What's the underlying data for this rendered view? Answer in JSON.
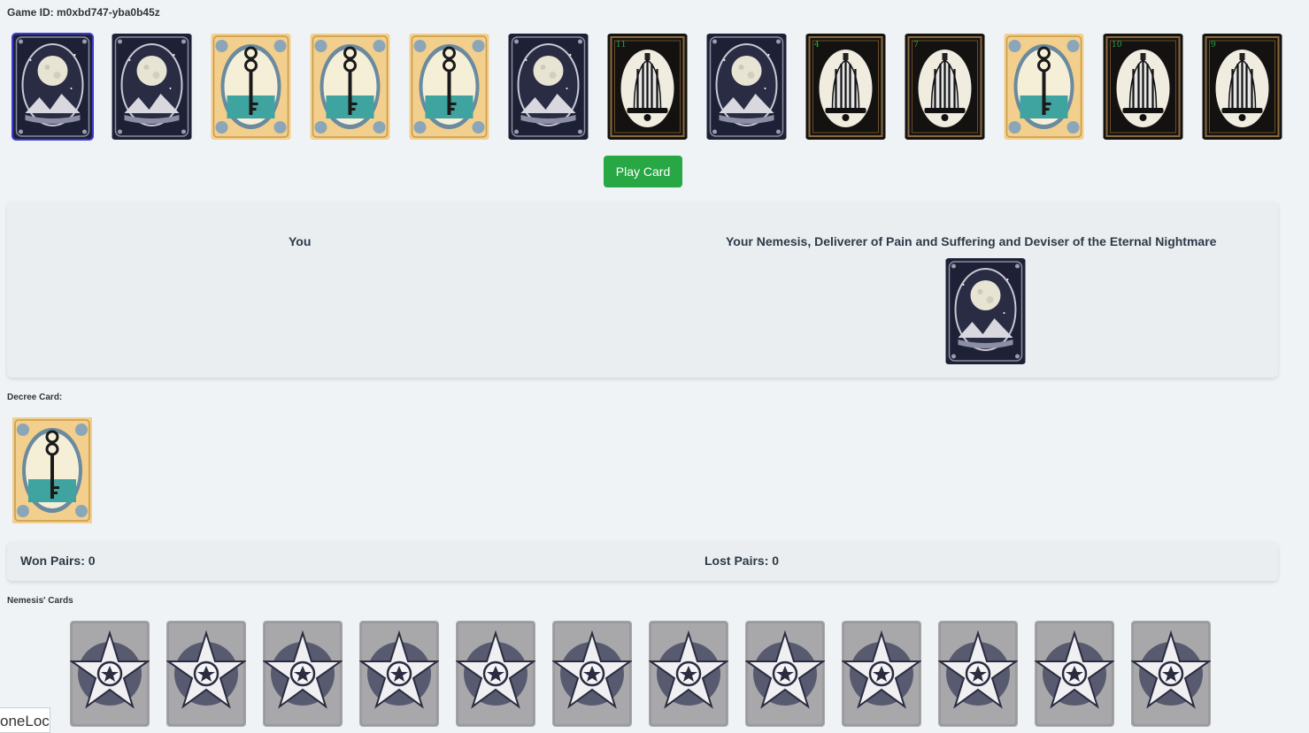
{
  "game": {
    "id_text": "Game ID: m0xbd747-yba0b45z"
  },
  "hand": [
    {
      "type": "moon",
      "num": "",
      "selected": true
    },
    {
      "type": "moon",
      "num": ""
    },
    {
      "type": "key",
      "num": ""
    },
    {
      "type": "key",
      "num": ""
    },
    {
      "type": "key",
      "num": ""
    },
    {
      "type": "moon",
      "num": ""
    },
    {
      "type": "bell",
      "num": "11"
    },
    {
      "type": "moon",
      "num": ""
    },
    {
      "type": "bell",
      "num": "4"
    },
    {
      "type": "bell",
      "num": "7"
    },
    {
      "type": "key",
      "num": ""
    },
    {
      "type": "bell",
      "num": "10"
    },
    {
      "type": "bell",
      "num": "9"
    }
  ],
  "play_button": {
    "label": "Play Card"
  },
  "battle": {
    "you_label": "You",
    "nemesis_label": "Your Nemesis, Deliverer of Pain and Suffering and Deviser of the Eternal Nightmare",
    "nemesis_card": {
      "type": "moon",
      "num": ""
    }
  },
  "decree": {
    "label": "Decree Card:",
    "card": {
      "type": "key"
    }
  },
  "pairs": {
    "won_text": "Won Pairs:  0",
    "lost_text": "Lost Pairs:  0"
  },
  "nemesis_cards": {
    "label": "Nemesis' Cards",
    "count": 12
  },
  "corner_text": "oneLoc",
  "colors": {
    "play_button": "#28a745",
    "moon_bg": "#1e2035",
    "bell_bg": "#141210",
    "key_bg": "#f2cf8c",
    "back_bg": "#a8a8aa"
  }
}
